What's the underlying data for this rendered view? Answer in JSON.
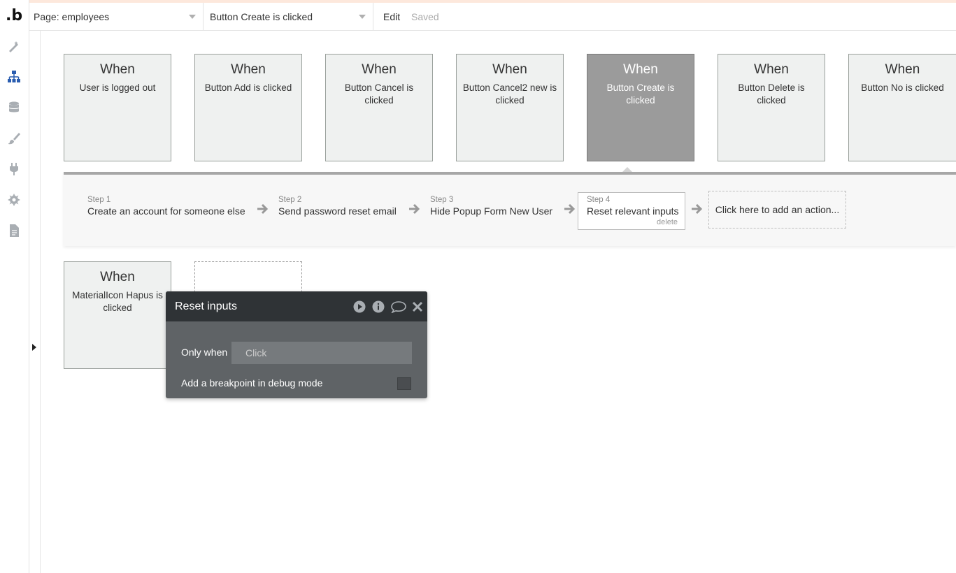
{
  "app": {
    "logo": ".b"
  },
  "sidebar": {
    "icons": [
      "design-icon",
      "workflow-icon",
      "data-icon",
      "styles-icon",
      "plugins-icon",
      "settings-icon",
      "logs-icon"
    ]
  },
  "topbar": {
    "page_select": "Page: employees",
    "event_select": "Button Create is clicked",
    "edit_label": "Edit",
    "saved_label": "Saved"
  },
  "events": [
    {
      "when": "When",
      "desc": "User is logged out"
    },
    {
      "when": "When",
      "desc": "Button Add is clicked"
    },
    {
      "when": "When",
      "desc": "Button Cancel is clicked"
    },
    {
      "when": "When",
      "desc": "Button Cancel2 new is clicked"
    },
    {
      "when": "When",
      "desc": "Button Create is clicked"
    },
    {
      "when": "When",
      "desc": "Button Delete is clicked"
    },
    {
      "when": "When",
      "desc": "Button No is clicked"
    }
  ],
  "steps": [
    {
      "num": "Step 1",
      "title": "Create an account for someone else"
    },
    {
      "num": "Step 2",
      "title": "Send password reset email"
    },
    {
      "num": "Step 3",
      "title": "Hide Popup Form New User"
    },
    {
      "num": "Step 4",
      "title": "Reset relevant inputs",
      "delete": "delete"
    }
  ],
  "add_action": "Click here to add an action...",
  "event_row2": {
    "when": "When",
    "desc": "MaterialIcon Hapus is clicked"
  },
  "property_editor": {
    "title": "Reset inputs",
    "only_when_label": "Only when",
    "only_when_placeholder": "Click",
    "breakpoint_label": "Add a breakpoint in debug mode"
  },
  "colors": {
    "selected_card": "#9b9b9b",
    "workflow_icon": "#2a5db0",
    "panel_bg": "#5f6366"
  }
}
